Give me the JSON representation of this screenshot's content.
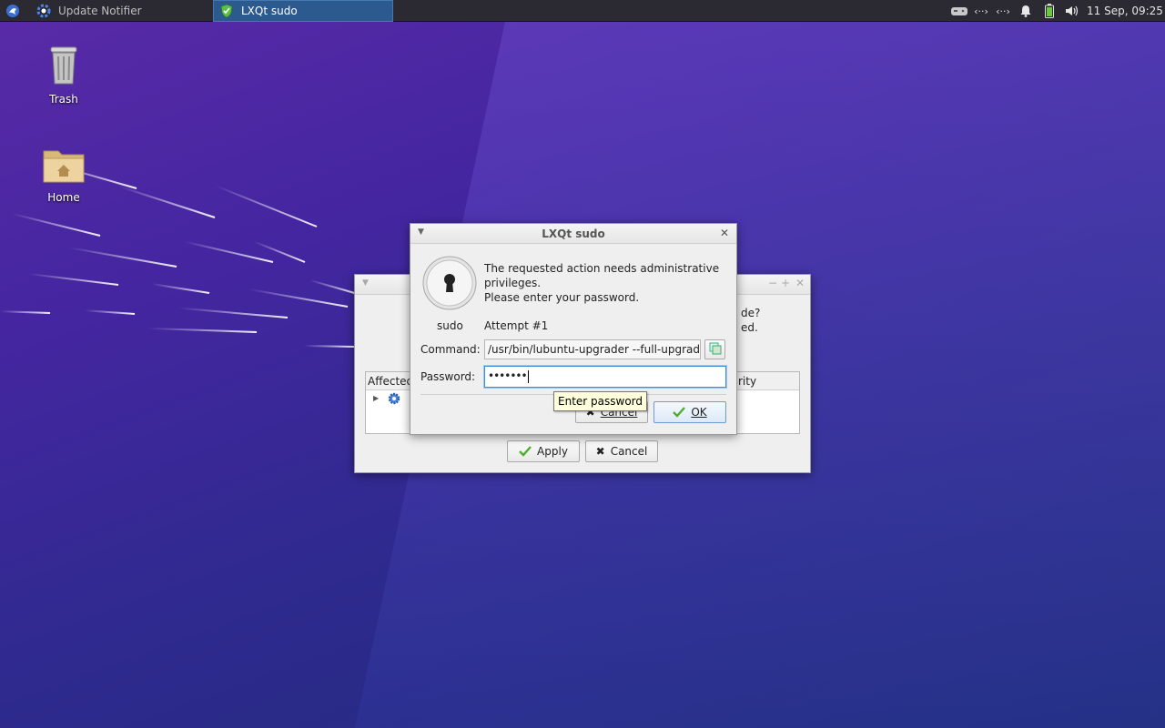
{
  "taskbar": {
    "tasks": [
      {
        "label": "Update Notifier"
      },
      {
        "label": "LXQt sudo"
      }
    ],
    "clock": "11 Sep, 09:25"
  },
  "desktop": {
    "icons": [
      {
        "label": "Trash"
      },
      {
        "label": "Home"
      }
    ]
  },
  "background_window": {
    "question_fragment": "de?",
    "line2_fragment": "ed.",
    "column_affected": "Affected",
    "column_right": "rity",
    "apply_label": "Apply",
    "cancel_label": "Cancel"
  },
  "sudo_dialog": {
    "title": "LXQt sudo",
    "message_line1": "The requested action needs administrative",
    "message_line2": "privileges.",
    "message_line3": "Please enter your password.",
    "user": "sudo",
    "attempt": "Attempt #1",
    "command_label": "Command:",
    "command_value": "/usr/bin/lubuntu-upgrader --full-upgrade",
    "password_label": "Password:",
    "password_value": "•••••••",
    "tooltip": "Enter password",
    "cancel_label": "Cancel",
    "ok_label": "OK"
  },
  "colors": {
    "taskbar_bg": "#2b2a33",
    "active_task": "#2c5a8f",
    "focus_border": "#3d8ee0",
    "tooltip_bg": "#ffffdc"
  }
}
